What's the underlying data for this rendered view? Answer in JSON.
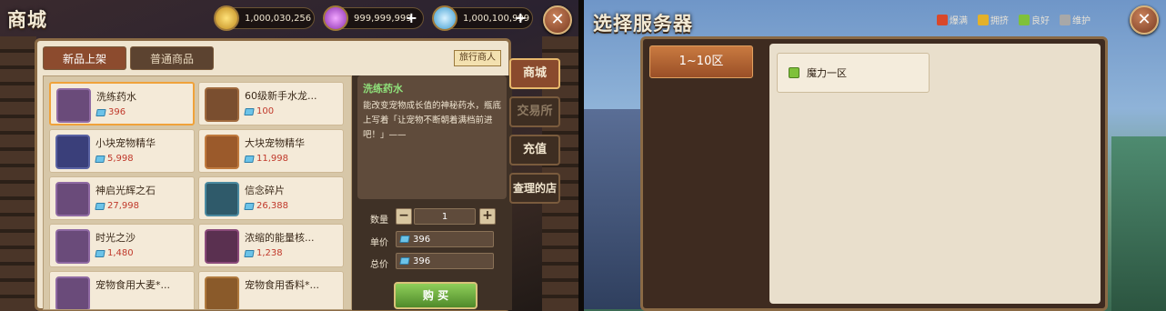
{
  "shop": {
    "title": "商城",
    "currencies": [
      {
        "name": "gold-coin",
        "value": "1,000,030,256"
      },
      {
        "name": "purple-gem",
        "value": "999,999,999"
      },
      {
        "name": "diamond",
        "value": "1,000,100,999"
      }
    ],
    "tabs": [
      "新品上架",
      "普通商品"
    ],
    "merchant_tag": "旅行商人",
    "items": [
      {
        "name": "洗练药水",
        "price": "396"
      },
      {
        "name": "60级新手水龙...",
        "price": "100"
      },
      {
        "name": "小块宠物精华",
        "price": "5,998"
      },
      {
        "name": "大块宠物精华",
        "price": "11,998"
      },
      {
        "name": "神启光辉之石",
        "price": "27,998"
      },
      {
        "name": "信念碎片",
        "price": "26,388"
      },
      {
        "name": "时光之沙",
        "price": "1,480"
      },
      {
        "name": "浓缩的能量核...",
        "price": "1,238"
      },
      {
        "name": "宠物食用大麦*...",
        "price": ""
      },
      {
        "name": "宠物食用香料*...",
        "price": ""
      }
    ],
    "detail": {
      "name": "洗练药水",
      "desc": "能改变宠物成长值的神秘药水，瓶底上写着「让宠物不断朝着满档前进吧！」——"
    },
    "qty_label": "数量",
    "qty_value": "1",
    "unit_label": "单价",
    "unit_price": "396",
    "total_label": "总价",
    "total_price": "396",
    "buy_label": "购 买",
    "side_tabs": [
      "商城",
      "交易所",
      "充值",
      "查理的店"
    ]
  },
  "server": {
    "title": "选择服务器",
    "legend": [
      {
        "label": "爆满",
        "color": "#d9482b"
      },
      {
        "label": "拥挤",
        "color": "#e3b12a"
      },
      {
        "label": "良好",
        "color": "#7fc13a"
      },
      {
        "label": "维护",
        "color": "#a8a8a8"
      }
    ],
    "zone": "1~10区",
    "servers": [
      {
        "name": "魔力一区",
        "status_color": "#7fc13a"
      }
    ]
  },
  "colors": {
    "accent": "#8a4a2d",
    "price": "#c0392b",
    "good": "#7fc13a"
  }
}
